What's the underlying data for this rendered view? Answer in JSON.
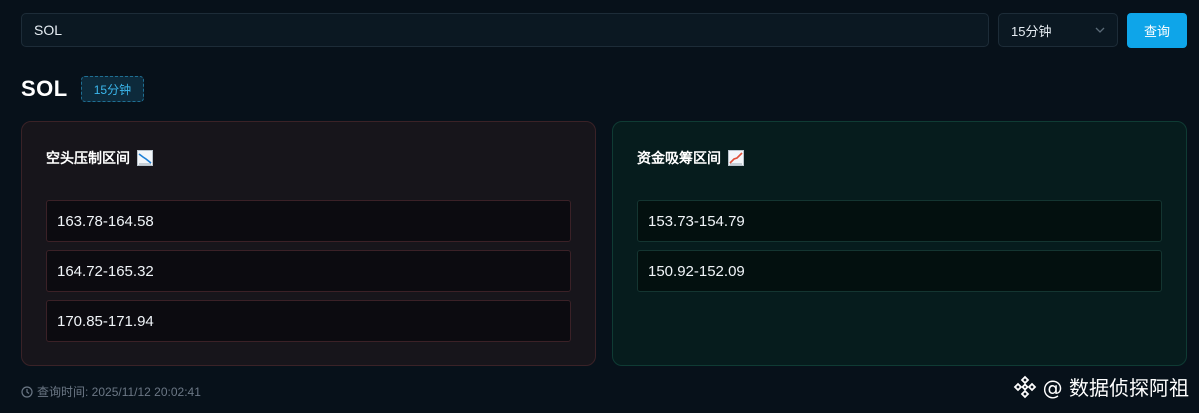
{
  "search": {
    "value": "SOL"
  },
  "interval_select": {
    "selected": "15分钟"
  },
  "query_button": {
    "label": "查询"
  },
  "header": {
    "symbol": "SOL",
    "interval_badge": "15分钟"
  },
  "bear_panel": {
    "title": "空头压制区间",
    "icon": "chart-decreasing-icon",
    "ranges": [
      "163.78-164.58",
      "164.72-165.32",
      "170.85-171.94"
    ]
  },
  "bull_panel": {
    "title": "资金吸筹区间",
    "icon": "chart-increasing-icon",
    "ranges": [
      "153.73-154.79",
      "150.92-152.09"
    ]
  },
  "footer": {
    "query_time": "查询时间: 2025/11/12 20:02:41"
  },
  "watermark": {
    "text": "@ 数据侦探阿祖"
  },
  "colors": {
    "accent": "#0ea5e9",
    "bear_border": "#3a2227",
    "bull_border": "#0f3b34"
  }
}
